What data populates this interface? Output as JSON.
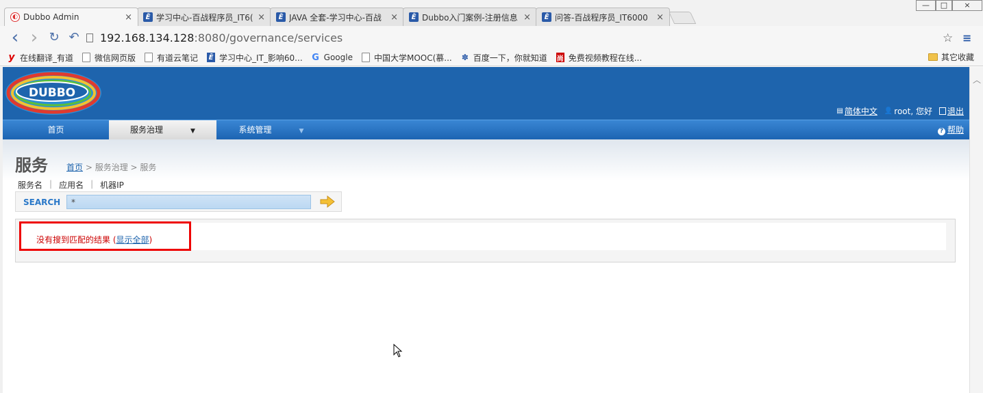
{
  "browser": {
    "tabs": [
      {
        "label": "Dubbo Admin",
        "close": "×",
        "icon": "dubbo-favicon"
      },
      {
        "label": "学习中心-百战程序员_IT6(",
        "close": "×",
        "icon": "it-favicon"
      },
      {
        "label": "JAVA 全套-学习中心-百战",
        "close": "×",
        "icon": "it-favicon"
      },
      {
        "label": "Dubbo入门案例-注册信息",
        "close": "×",
        "icon": "it-favicon"
      },
      {
        "label": "问答-百战程序员_IT6000",
        "close": "×",
        "icon": "it-favicon"
      }
    ],
    "window_controls": {
      "minimize": "—",
      "maximize": "□",
      "close": "×"
    },
    "nav": {
      "back": "‹",
      "forward": "›",
      "reload": "↻",
      "undo": "↶"
    },
    "url": {
      "host": "192.168.134.128",
      "rest": ":8080/governance/services"
    },
    "star": "☆",
    "menu": "≡",
    "bookmarks": [
      {
        "label": "在线翻译_有道",
        "icon": "youdao-icon"
      },
      {
        "label": "微信网页版",
        "icon": "page-icon"
      },
      {
        "label": "有道云笔记",
        "icon": "page-icon"
      },
      {
        "label": "学习中心_IT_影响60...",
        "icon": "it-favicon"
      },
      {
        "label": "Google",
        "icon": "google-icon"
      },
      {
        "label": "中国大学MOOC(慕...",
        "icon": "page-icon"
      },
      {
        "label": "百度一下，你就知道",
        "icon": "baidu-icon"
      },
      {
        "label": "免费视频教程在线...",
        "icon": "shang-icon"
      }
    ],
    "other_bookmarks": "其它收藏"
  },
  "header": {
    "logo_text": "DUBBO",
    "language": "简体中文",
    "user": "root, 您好",
    "logout": "退出"
  },
  "menu": {
    "items": [
      {
        "label": "首页"
      },
      {
        "label": "服务治理",
        "caret": "▼"
      },
      {
        "label": "系统管理",
        "caret": "▼"
      }
    ],
    "help": "帮助",
    "help_icon": "?"
  },
  "page": {
    "title": "服务",
    "breadcrumb": {
      "home": "首页",
      "trail": " > 服务治理 > 服务"
    }
  },
  "search": {
    "tabs": [
      "服务名",
      "应用名",
      "机器IP"
    ],
    "separator": "|",
    "label": "SEARCH",
    "value": "*"
  },
  "result": {
    "message": "没有搜到匹配的结果",
    "open_paren": " (",
    "show_all": "显示全部",
    "close_paren": ")"
  },
  "colors": {
    "header_blue": "#1e64ad",
    "highlight_red": "#e00000",
    "result_red": "#cc0000"
  }
}
